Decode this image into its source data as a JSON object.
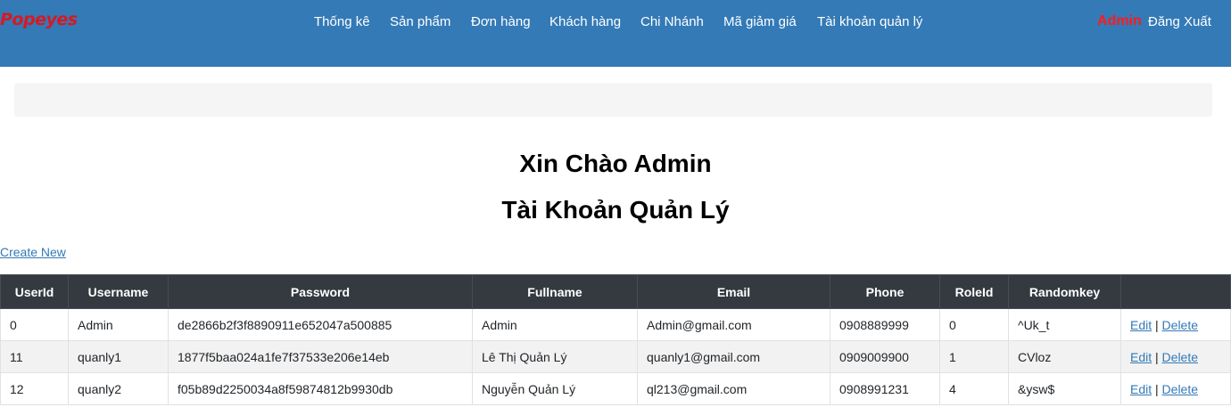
{
  "brand": {
    "logo_text": "POPEYES",
    "color": "#d71920"
  },
  "nav": {
    "items": [
      {
        "label": "Thống kê"
      },
      {
        "label": "Sản phẩm"
      },
      {
        "label": "Đơn hàng"
      },
      {
        "label": "Khách hàng"
      },
      {
        "label": "Chi Nhánh"
      },
      {
        "label": "Mã giảm giá"
      },
      {
        "label": "Tài khoản quản lý"
      }
    ],
    "admin_name": "Admin",
    "logout_label": "Đăng Xuất"
  },
  "page": {
    "greeting": "Xin Chào Admin",
    "title": "Tài Khoản Quản Lý",
    "create_label": "Create New"
  },
  "table": {
    "headers": [
      "UserId",
      "Username",
      "Password",
      "Fullname",
      "Email",
      "Phone",
      "RoleId",
      "Randomkey",
      ""
    ],
    "rows": [
      {
        "userid": "0",
        "username": "Admin",
        "password": "de2866b2f3f8890911e652047a500885",
        "fullname": "Admin",
        "email": "Admin@gmail.com",
        "phone": "0908889999",
        "roleid": "0",
        "randomkey": "^Uk_t",
        "edit": "Edit",
        "sep": "|",
        "delete": "Delete"
      },
      {
        "userid": "11",
        "username": "quanly1",
        "password": "1877f5baa024a1fe7f37533e206e14eb",
        "fullname": "Lê Thị Quản Lý",
        "email": "quanly1@gmail.com",
        "phone": "0909009900",
        "roleid": "1",
        "randomkey": "CVloz",
        "edit": "Edit",
        "sep": "|",
        "delete": "Delete"
      },
      {
        "userid": "12",
        "username": "quanly2",
        "password": "f05b89d2250034a8f59874812b9930db",
        "fullname": "Nguyễn Quản Lý",
        "email": "ql213@gmail.com",
        "phone": "0908991231",
        "roleid": "4",
        "randomkey": "&ysw$",
        "edit": "Edit",
        "sep": "|",
        "delete": "Delete"
      }
    ]
  },
  "colors": {
    "navbar": "#337ab7",
    "table_header": "#343a40",
    "link": "#337ab7",
    "admin": "#ff1a1a"
  }
}
